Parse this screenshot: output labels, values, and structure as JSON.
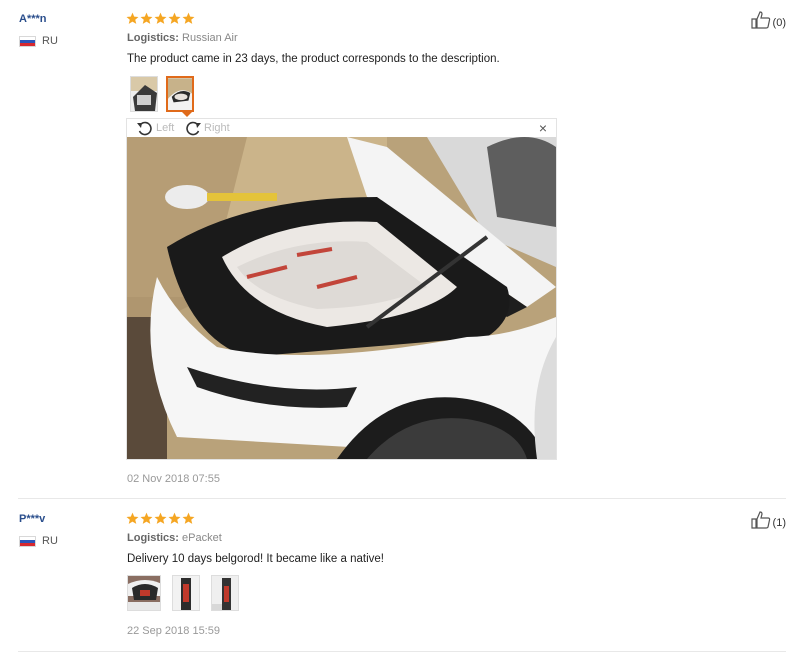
{
  "reviews": [
    {
      "user": "A***n",
      "country": "RU",
      "stars": 5,
      "logistics_label": "Logistics:",
      "logistics_value": "Russian Air",
      "text": "The product came in 23 days, the product corresponds to the description.",
      "date": "02 Nov 2018 07:55",
      "helpful_count": "(0)",
      "viewer": {
        "rotate_left": "Left",
        "rotate_right": "Right",
        "close": "×"
      }
    },
    {
      "user": "P***v",
      "country": "RU",
      "stars": 5,
      "logistics_label": "Logistics:",
      "logistics_value": "ePacket",
      "text": "Delivery 10 days belgorod! It became like a native!",
      "date": "22 Sep 2018 15:59",
      "helpful_count": "(1)"
    }
  ],
  "colors": {
    "star": "#f5a623",
    "user": "#2a4e8c",
    "active_thumb": "#e06a1a"
  }
}
